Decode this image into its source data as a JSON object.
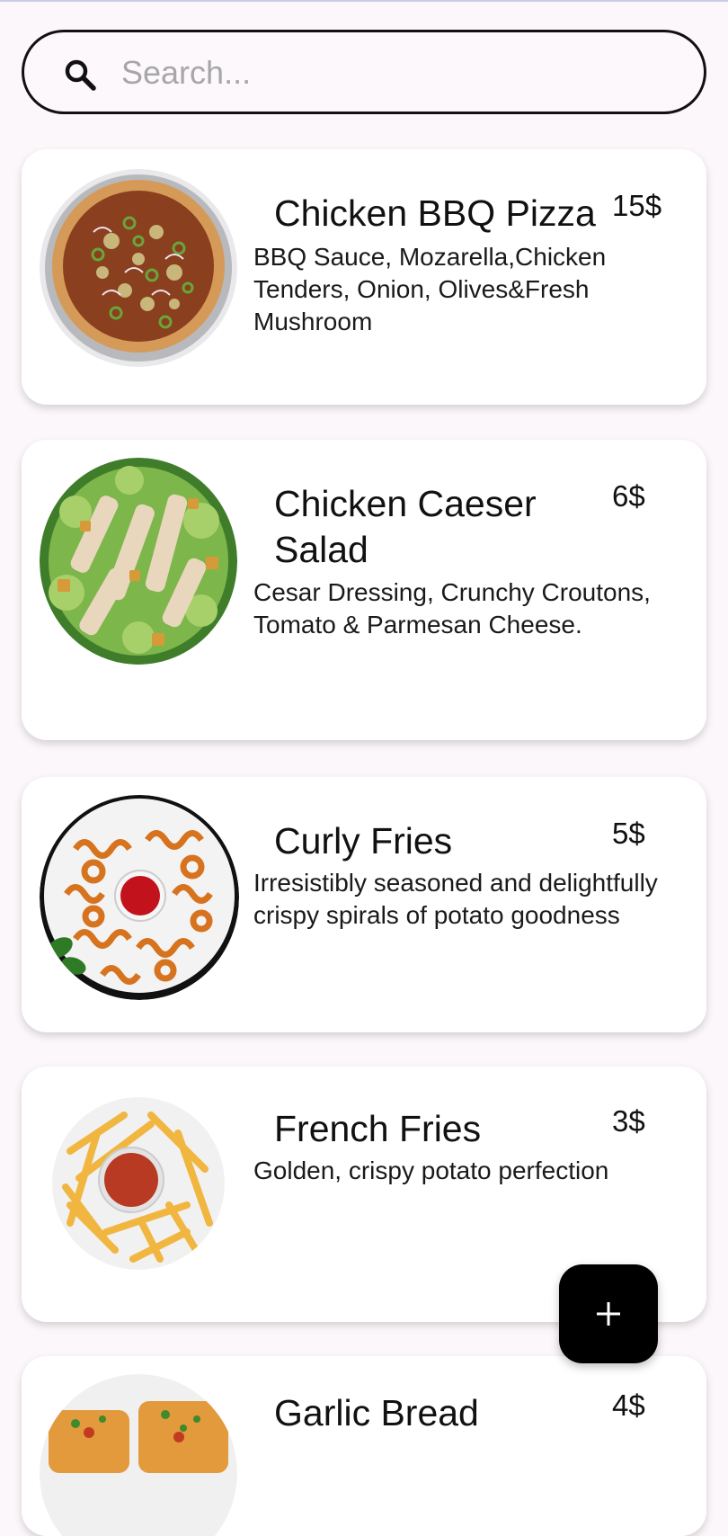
{
  "search": {
    "placeholder": "Search...",
    "value": ""
  },
  "menu": [
    {
      "name": "Chicken BBQ Pizza",
      "price": "15$",
      "description": "BBQ Sauce, Mozarella,Chicken Tenders, Onion, Olives&Fresh Mushroom",
      "image": "pizza"
    },
    {
      "name": "Chicken Caeser Salad",
      "price": "6$",
      "description": "Cesar Dressing, Crunchy Croutons, Tomato & Parmesan Cheese.",
      "image": "salad"
    },
    {
      "name": "Curly Fries",
      "price": "5$",
      "description": "Irresistibly seasoned and delightfully crispy spirals of potato goodness",
      "image": "curly-fries"
    },
    {
      "name": "French Fries",
      "price": "3$",
      "description": "Golden, crispy potato perfection",
      "image": "french-fries"
    },
    {
      "name": "Garlic Bread",
      "price": "4$",
      "description": "",
      "image": "garlic-bread"
    }
  ],
  "fab": {
    "label": "+",
    "icon": "plus-icon"
  }
}
